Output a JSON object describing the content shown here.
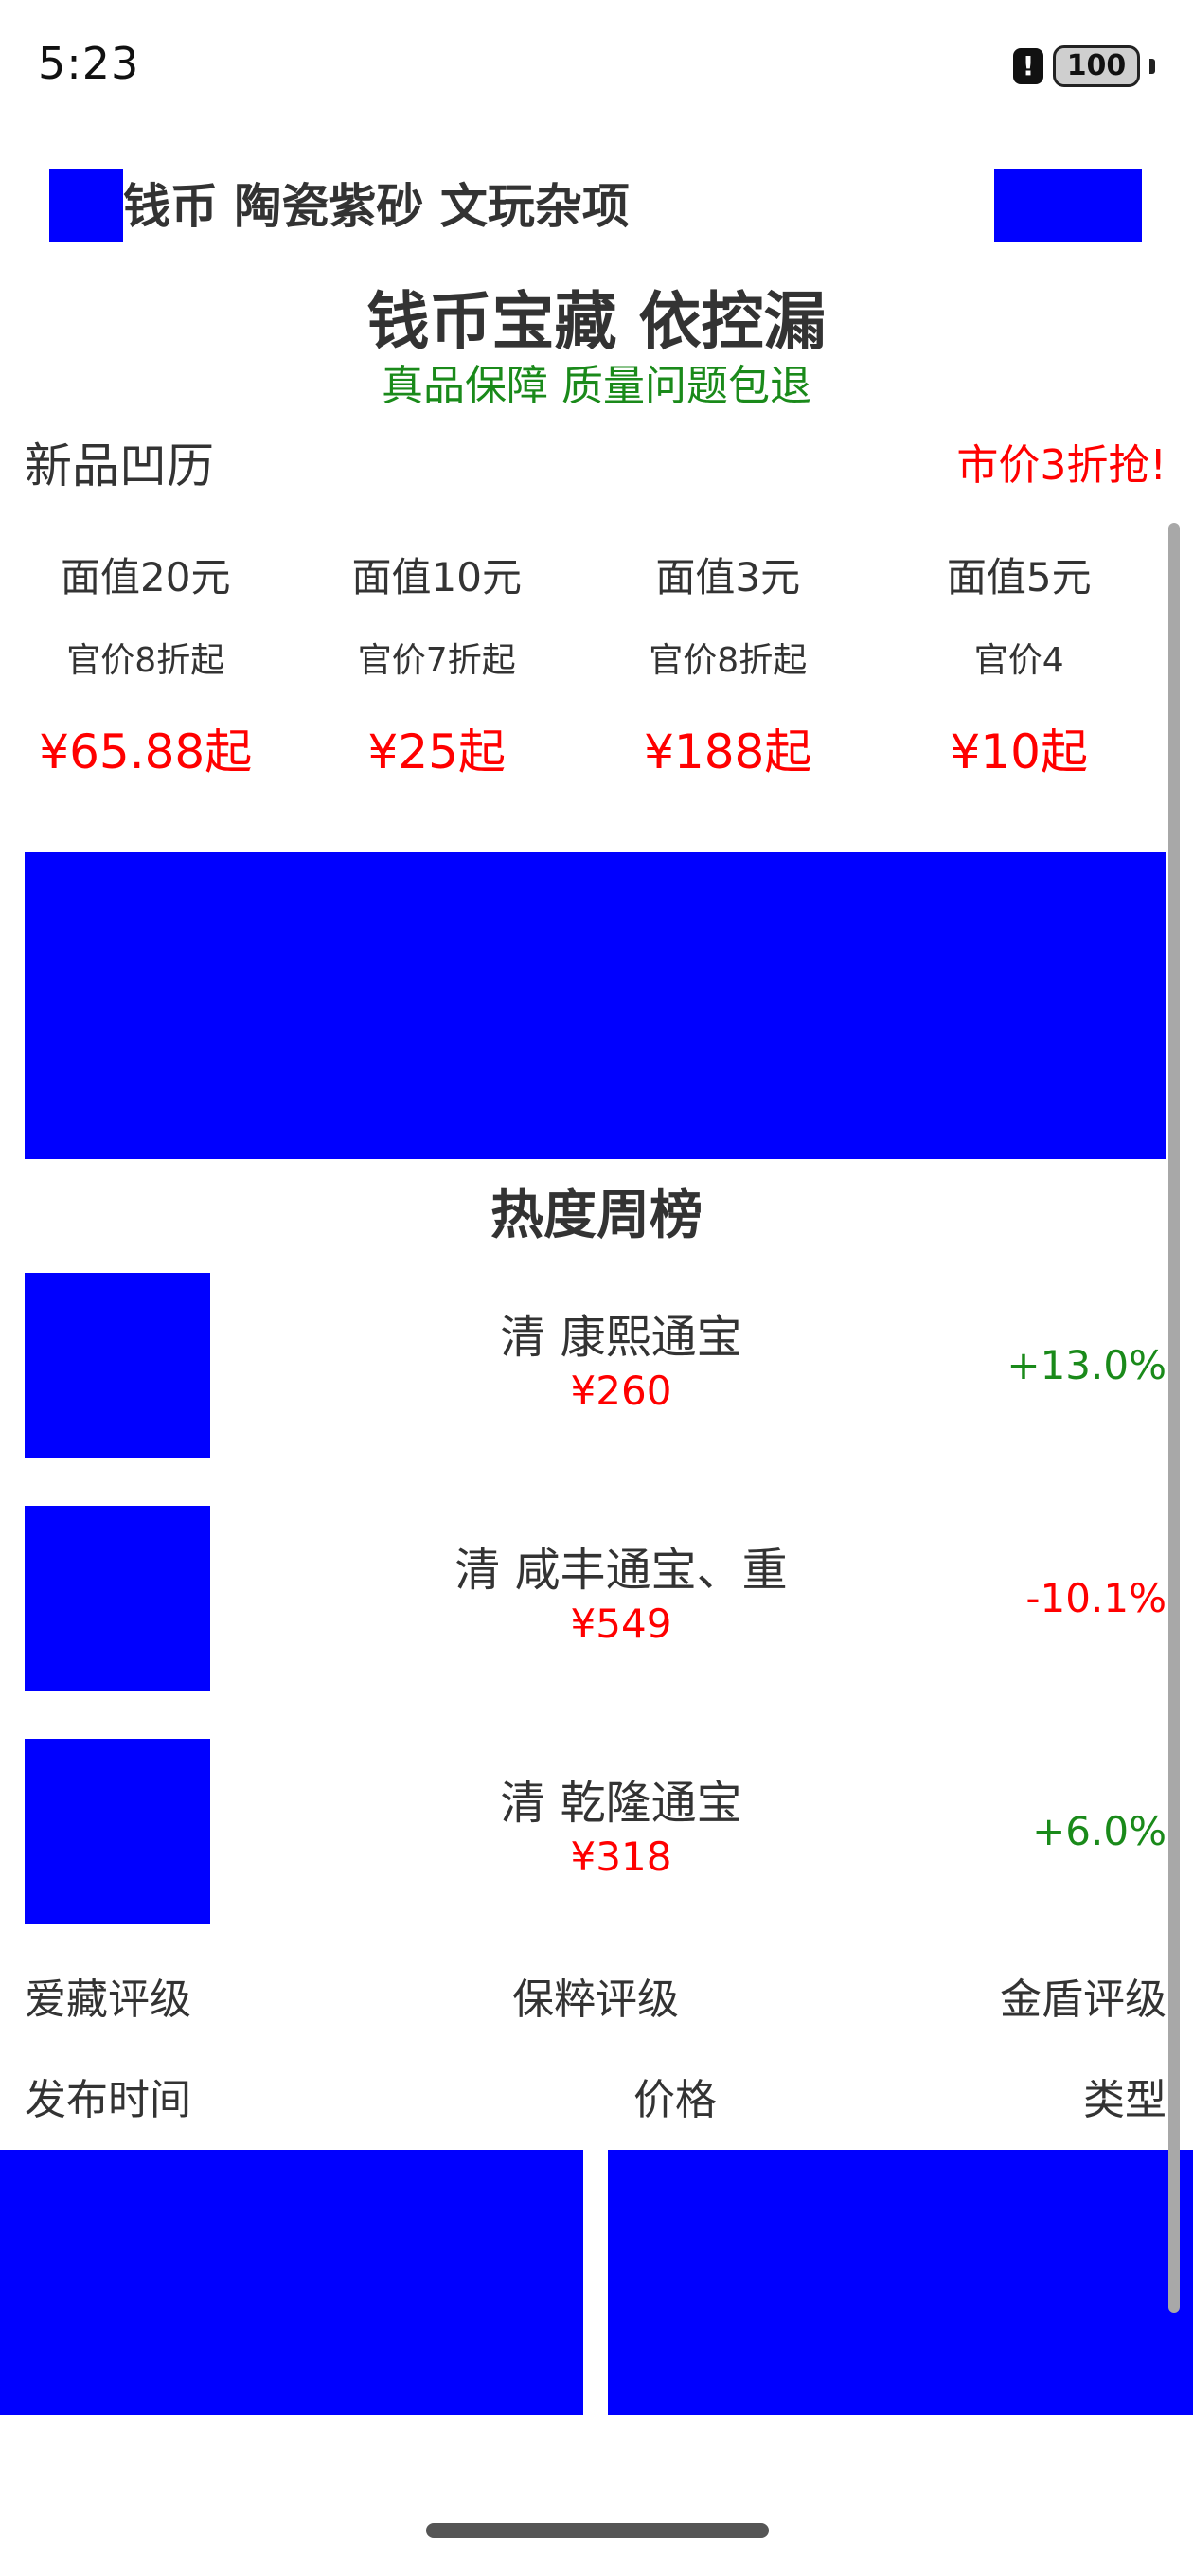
{
  "status_bar": {
    "time": "5:23",
    "alert_glyph": "!",
    "battery_level": "100"
  },
  "header": {
    "categories": "钱币 陶瓷紫砂 文玩杂项"
  },
  "headline": {
    "title": "钱币宝藏 依控漏",
    "subtitle": "真品保障 质量问题包退"
  },
  "new_section": {
    "title": "新品凹历",
    "promo": "市价3折抢!"
  },
  "products": [
    {
      "face": "面值20元",
      "discount": "官价8折起",
      "price": "¥65.88起"
    },
    {
      "face": "面值10元",
      "discount": "官价7折起",
      "price": "¥25起"
    },
    {
      "face": "面值3元",
      "discount": "官价8折起",
      "price": "¥188起"
    },
    {
      "face": "面值5元",
      "discount": "官价4",
      "price": "¥10起"
    }
  ],
  "ranking": {
    "title": "热度周榜",
    "items": [
      {
        "name": "清 康熙通宝",
        "price": "¥260",
        "change": "+13.0%",
        "trend": "up"
      },
      {
        "name": "清 咸丰通宝、重",
        "price": "¥549",
        "change": "-10.1%",
        "trend": "down"
      },
      {
        "name": "清 乾隆通宝",
        "price": "¥318",
        "change": "+6.0%",
        "trend": "up"
      }
    ]
  },
  "filters": {
    "ratings": [
      "爱藏评级",
      "保粹评级",
      "金盾评级"
    ],
    "sorts": [
      "发布时间",
      "价格",
      "类型"
    ]
  },
  "colors": {
    "placeholder": "#0000ff",
    "accent_red": "#ff0000",
    "accent_green": "#1a8a1a"
  }
}
